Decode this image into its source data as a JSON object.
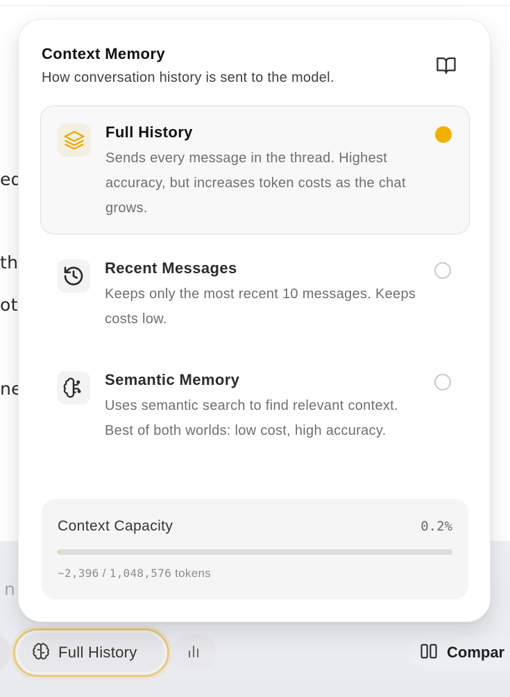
{
  "background": {
    "fragments": [
      "ed,",
      "the",
      "ot",
      "nes"
    ],
    "composer_placeholder": "n",
    "mode_button": {
      "label": "Full History",
      "icon": "brain-icon"
    },
    "stats_button": {
      "icon": "bar-chart-icon"
    },
    "compare_button": {
      "label": "Compar",
      "icon": "columns-icon"
    }
  },
  "popover": {
    "title": "Context Memory",
    "subtitle": "How conversation history is sent to the model.",
    "help_icon": "book-open-icon",
    "options": [
      {
        "title": "Full History",
        "description": "Sends every message in the thread. Highest accuracy, but increases token costs as the chat grows.",
        "icon": "layers-icon",
        "selected": true
      },
      {
        "title": "Recent Messages",
        "description": "Keeps only the most recent 10 messages. Keeps costs low.",
        "icon": "history-icon",
        "selected": false
      },
      {
        "title": "Semantic Memory",
        "description": "Uses semantic search to find relevant context. Best of both worlds: low cost, high accuracy.",
        "icon": "brain-icon",
        "selected": false
      }
    ],
    "capacity": {
      "label": "Context Capacity",
      "percent_text": "0.2%",
      "fill_fraction": 0.0023,
      "used": "~2,396",
      "separator": " / ",
      "total": "1,048,576",
      "unit": " tokens"
    }
  },
  "colors": {
    "accent": "#f0b100",
    "radio_off": "#c9c9c9",
    "selected_bg": "#f8f8f8",
    "pill_border": "#e7c980"
  }
}
